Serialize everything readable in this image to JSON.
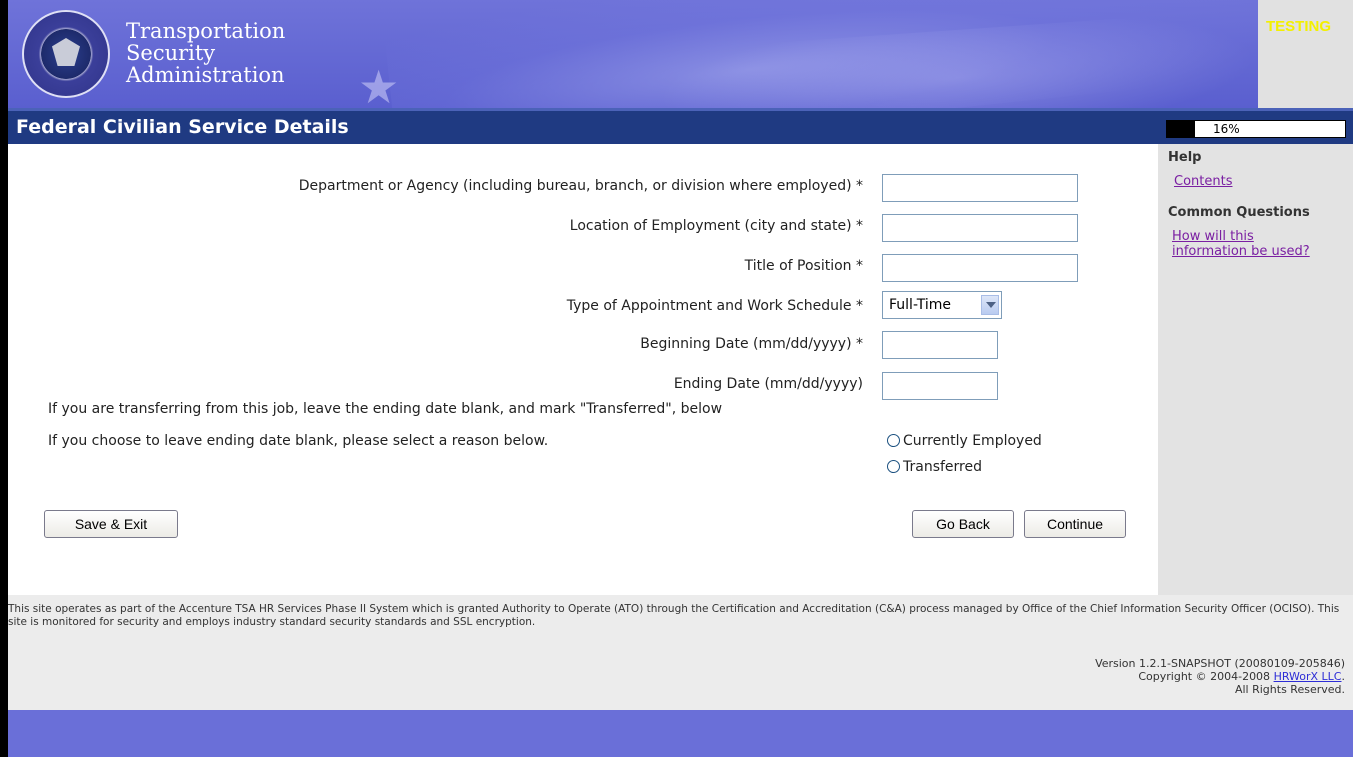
{
  "header": {
    "org_name_line1": "Transportation",
    "org_name_line2": "Security",
    "org_name_line3": "Administration",
    "testing_label": "TESTING",
    "seal_icon": "dhs-seal-icon"
  },
  "page": {
    "title": "Federal Civilian Service Details",
    "progress_percent": 16,
    "progress_label": "16%"
  },
  "form": {
    "department_label": "Department or Agency (including bureau, branch, or division where employed) *",
    "department_value": "",
    "location_label": "Location of Employment (city and state) *",
    "location_value": "",
    "title_label": "Title of Position *",
    "title_value": "",
    "appointment_label": "Type of Appointment and Work Schedule *",
    "appointment_selected": "Full-Time",
    "begin_label": "Beginning Date (mm/dd/yyyy) *",
    "begin_value": "",
    "end_label": "Ending Date (mm/dd/yyyy)",
    "end_value": "",
    "transfer_note": "If you are transferring from this job, leave the ending date blank, and mark \"Transferred\", below",
    "blank_reason_note": "If you choose to leave ending date blank, please select a reason below.",
    "radio_currently_employed": "Currently Employed",
    "radio_transferred": "Transferred"
  },
  "buttons": {
    "save_exit": "Save & Exit",
    "go_back": "Go Back",
    "continue": "Continue"
  },
  "help": {
    "heading": "Help",
    "contents_link": "Contents",
    "common_heading": "Common Questions",
    "question_link": "How will this information be used?"
  },
  "footer": {
    "legal_text": "This site operates as part of the Accenture TSA HR Services Phase II System which is granted Authority to Operate (ATO) through the Certification and Accreditation (C&A) process managed by Office of the Chief Information Security Officer (OCISO). This site is monitored for security and employs industry standard security standards and SSL encryption.",
    "version": "Version 1.2.1-SNAPSHOT (20080109-205846)",
    "copyright_prefix": "Copyright © 2004-2008 ",
    "copyright_link": "HRWorX LLC",
    "copyright_suffix": ".",
    "rights": "All Rights Reserved."
  },
  "colors": {
    "banner": "#5a5fcf",
    "titlebar": "#1f3a82",
    "link_visited": "#7a1fa2",
    "testing": "#f3f000"
  }
}
